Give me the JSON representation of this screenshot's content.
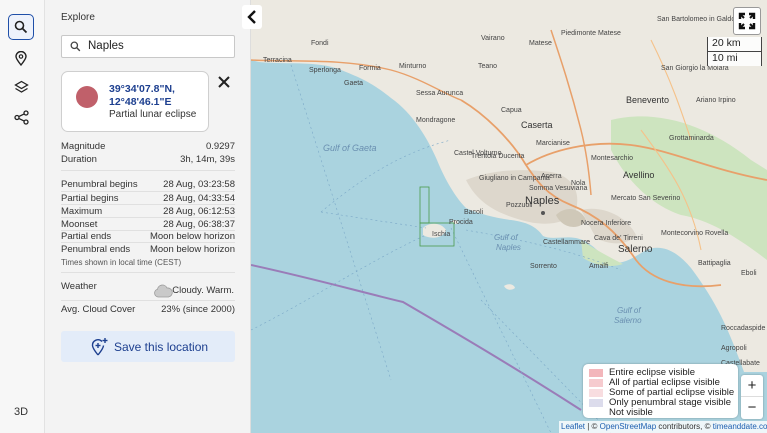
{
  "sidebar": {
    "tools": [
      {
        "icon": "search-icon",
        "active": true
      },
      {
        "icon": "location-pin-icon",
        "active": false
      },
      {
        "icon": "layers-icon",
        "active": false
      },
      {
        "icon": "share-icon",
        "active": false
      }
    ],
    "three_d_label": "3D"
  },
  "panel": {
    "title": "Explore",
    "search": {
      "value": "Naples",
      "placeholder": ""
    },
    "location": {
      "coords_line1": "39°34'07.8\"N,",
      "coords_line2": "12°48'46.1\"E",
      "eclipse_type": "Partial lunar eclipse",
      "color": "#c0606a"
    },
    "stats": [
      {
        "label": "Magnitude",
        "value": "0.9297"
      },
      {
        "label": "Duration",
        "value": "3h, 14m, 39s"
      }
    ],
    "times": [
      {
        "label": "Penumbral begins",
        "value": "28 Aug, 03:23:58"
      },
      {
        "label": "Partial begins",
        "value": "28 Aug, 04:33:54"
      },
      {
        "label": "Maximum",
        "value": "28 Aug, 06:12:53"
      },
      {
        "label": "Moonset",
        "value": "28 Aug, 06:38:37"
      },
      {
        "label": "Partial ends",
        "value": "Moon below horizon"
      },
      {
        "label": "Penumbral ends",
        "value": "Moon below horizon"
      }
    ],
    "timezone_note": "Times shown in local time (CEST)",
    "weather": {
      "label": "Weather",
      "value": "Cloudy. Warm.",
      "icon": "cloud-icon"
    },
    "cloud_cover": {
      "label": "Avg. Cloud Cover",
      "value": "23% (since 2000)"
    },
    "save_label": "Save this location"
  },
  "map": {
    "labels": {
      "gulf_gaeta": "Gulf of Gaeta",
      "gulf_naples_1": "Gulf of",
      "gulf_naples_2": "Naples",
      "gulf_salerno_1": "Gulf of",
      "gulf_salerno_2": "Salerno",
      "naples": "Naples",
      "salerno": "Salerno",
      "caserta": "Caserta",
      "avellino": "Avellino",
      "benevento": "Benevento",
      "gaeta": "Gaeta",
      "terracina": "Terracina",
      "ischia": "Ischia",
      "procida": "Procida",
      "sorrento": "Sorrento",
      "amalfi": "Amalfi",
      "pozzuoli": "Pozzuoli",
      "giugliano": "Giugliano in Campania",
      "mondragone": "Mondragone",
      "capua": "Capua",
      "teano": "Teano",
      "bacoli": "Bacoli",
      "castellammare": "Castellammare",
      "battipaglia": "Battipaglia",
      "eboli": "Eboli",
      "minturno": "Minturno",
      "formia": "Formia",
      "matese": "Matese",
      "san_bartolomeo": "San Bartolomeo in Galdo",
      "ariano": "Ariano Irpino",
      "grottaminarda": "Grottaminarda",
      "montecorvino": "Montecorvino Rovella",
      "nocera": "Nocera Inferiore",
      "cava": "Cava de' Tirreni",
      "acerra": "Acerra",
      "somma": "Somma Vesuviana",
      "castel_volturno": "Castel Volturno",
      "sessa": "Sessa Aurunca",
      "piedimonte": "Piedimonte Matese",
      "san_giorgio": "San Giorgio la Molara",
      "mercato": "Mercato San Severino",
      "trentola": "Trentola Ducenta",
      "marcianise": "Marcianise",
      "roccadaspide": "Roccadaspide",
      "fondi": "Fondi",
      "sperlonga": "Sperlonga",
      "vairano": "Vairano",
      "montesarchio": "Montesarchio",
      "nola": "Nola",
      "agropoli": "Agropoli",
      "castellabate": "Castellabate"
    },
    "scale": {
      "km": "20 km",
      "mi": "10 mi"
    },
    "legend": [
      {
        "label": "Entire eclipse visible",
        "color": "#f3b6bb"
      },
      {
        "label": "All of partial eclipse visible",
        "color": "#f6cbcf"
      },
      {
        "label": "Some of partial eclipse visible",
        "color": "#f8dde0"
      },
      {
        "label": "Only penumbral stage visible",
        "color": "#dcdcec"
      },
      {
        "label": "Not visible",
        "color": "#ffffff"
      }
    ],
    "zoom_in": "+",
    "zoom_out": "−",
    "attribution": {
      "leaflet": "Leaflet",
      "sep1": " | © ",
      "osm": "OpenStreetMap",
      "contrib": " contributors, © ",
      "tad": "timeanddate.com"
    },
    "colors": {
      "sea": "#aad3df",
      "land": "#ece9e1",
      "urban": "#ddd7cc",
      "road": "#e8a06a",
      "boundary": "#9a7cb8"
    }
  }
}
